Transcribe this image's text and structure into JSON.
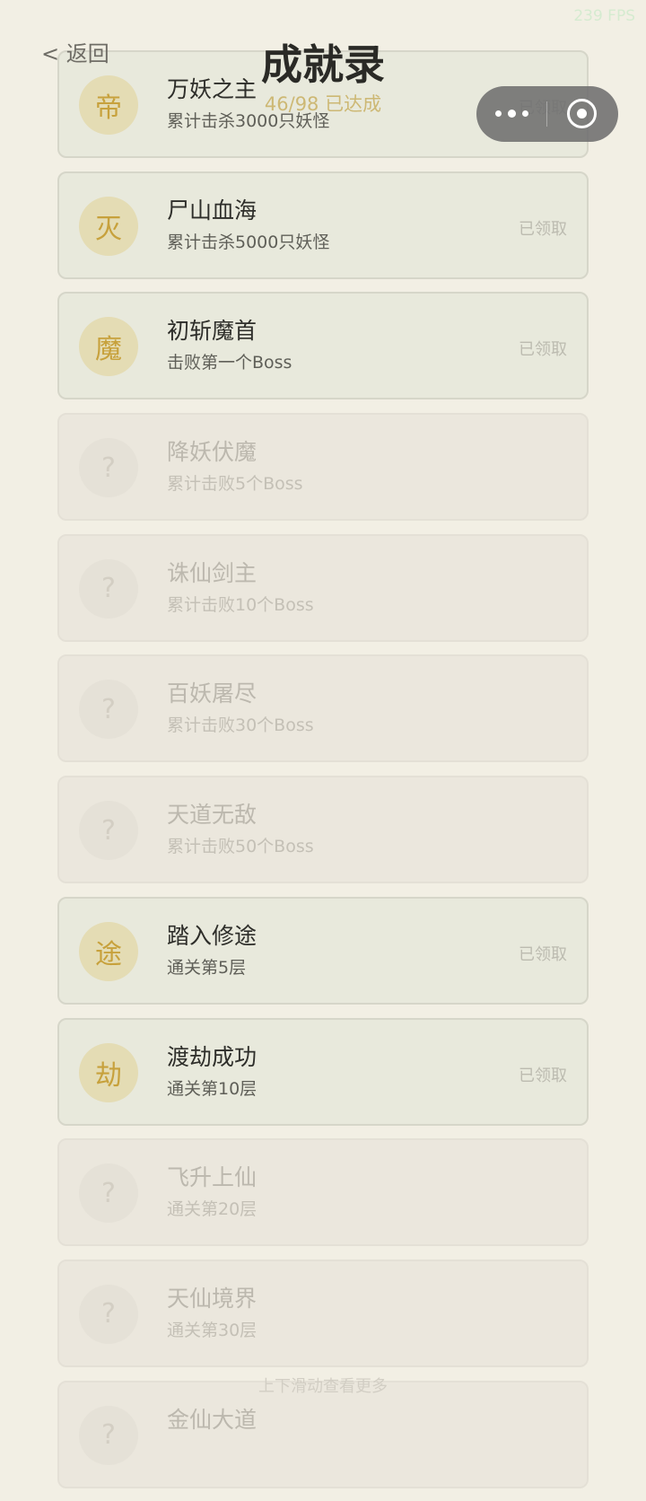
{
  "header": {
    "back_label": "< 返回",
    "title": "成就录",
    "progress": "46/98 已达成"
  },
  "overlay": {
    "fps": "239 FPS"
  },
  "footer": {
    "scroll_hint": "上下滑动查看更多"
  },
  "achievements": [
    {
      "badge": "帝",
      "title": "万妖之主",
      "desc": "累计击杀3000只妖怪",
      "status": "已领取",
      "achieved": true
    },
    {
      "badge": "灭",
      "title": "尸山血海",
      "desc": "累计击杀5000只妖怪",
      "status": "已领取",
      "achieved": true
    },
    {
      "badge": "魔",
      "title": "初斩魔首",
      "desc": "击败第一个Boss",
      "status": "已领取",
      "achieved": true
    },
    {
      "badge": "?",
      "title": "降妖伏魔",
      "desc": "累计击败5个Boss",
      "status": "",
      "achieved": false
    },
    {
      "badge": "?",
      "title": "诛仙剑主",
      "desc": "累计击败10个Boss",
      "status": "",
      "achieved": false
    },
    {
      "badge": "?",
      "title": "百妖屠尽",
      "desc": "累计击败30个Boss",
      "status": "",
      "achieved": false
    },
    {
      "badge": "?",
      "title": "天道无敌",
      "desc": "累计击败50个Boss",
      "status": "",
      "achieved": false
    },
    {
      "badge": "途",
      "title": "踏入修途",
      "desc": "通关第5层",
      "status": "已领取",
      "achieved": true
    },
    {
      "badge": "劫",
      "title": "渡劫成功",
      "desc": "通关第10层",
      "status": "已领取",
      "achieved": true
    },
    {
      "badge": "?",
      "title": "飞升上仙",
      "desc": "通关第20层",
      "status": "",
      "achieved": false
    },
    {
      "badge": "?",
      "title": "天仙境界",
      "desc": "通关第30层",
      "status": "",
      "achieved": false
    },
    {
      "badge": "?",
      "title": "金仙大道",
      "desc": "",
      "status": "",
      "achieved": false
    }
  ]
}
